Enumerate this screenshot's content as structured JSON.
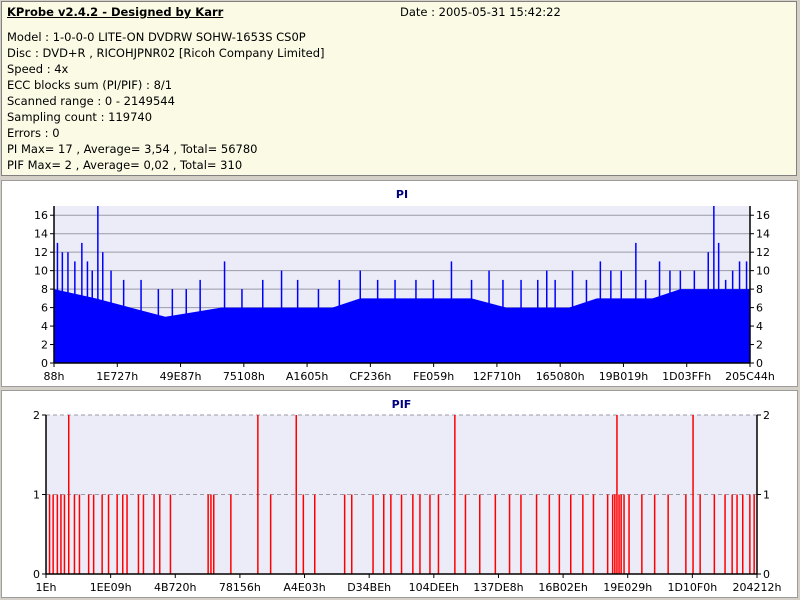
{
  "header": {
    "title": "KProbe v2.4.2 - Designed by Karr",
    "date": "Date : 2005-05-31 15:42:22",
    "lines": [
      "Model : 1-0-0-0 LITE-ON DVDRW SOHW-1653S CS0P",
      "Disc : DVD+R , RICOHJPNR02 [Ricoh Company Limited]",
      "Speed : 4x",
      "ECC blocks sum (PI/PIF) : 8/1",
      "Scanned range : 0 - 2149544",
      "Sampling count : 119740",
      "Errors : 0",
      "PI Max= 17 , Average= 3,54 , Total= 56780",
      "PIF Max= 2 , Average= 0,02 , Total= 310"
    ]
  },
  "colors": {
    "pi": "#0000ff",
    "pif": "#ff0000",
    "plot_bg": "#ececf8"
  },
  "chart_data": [
    {
      "type": "bar",
      "title": "PI",
      "ylim": [
        0,
        17
      ],
      "yticks": [
        "0",
        "2",
        "4",
        "6",
        "8",
        "10",
        "12",
        "14",
        "16"
      ],
      "xticks": [
        "88h",
        "1E727h",
        "49E87h",
        "75108h",
        "A1605h",
        "CF236h",
        "FE059h",
        "12F710h",
        "165080h",
        "19B019h",
        "1D03FFh",
        "205C44h"
      ],
      "baseline_profile": [
        {
          "x": 0.0,
          "y": 8
        },
        {
          "x": 0.06,
          "y": 7
        },
        {
          "x": 0.11,
          "y": 6
        },
        {
          "x": 0.16,
          "y": 5
        },
        {
          "x": 0.2,
          "y": 5.5
        },
        {
          "x": 0.24,
          "y": 6
        },
        {
          "x": 0.4,
          "y": 6
        },
        {
          "x": 0.44,
          "y": 7
        },
        {
          "x": 0.6,
          "y": 7
        },
        {
          "x": 0.65,
          "y": 6
        },
        {
          "x": 0.74,
          "y": 6
        },
        {
          "x": 0.78,
          "y": 7
        },
        {
          "x": 0.86,
          "y": 7
        },
        {
          "x": 0.9,
          "y": 8
        },
        {
          "x": 1.0,
          "y": 8
        }
      ],
      "spikes": [
        {
          "x": 0.005,
          "y": 13
        },
        {
          "x": 0.012,
          "y": 12
        },
        {
          "x": 0.02,
          "y": 12
        },
        {
          "x": 0.03,
          "y": 11
        },
        {
          "x": 0.04,
          "y": 13
        },
        {
          "x": 0.048,
          "y": 11
        },
        {
          "x": 0.055,
          "y": 10
        },
        {
          "x": 0.063,
          "y": 17
        },
        {
          "x": 0.07,
          "y": 12
        },
        {
          "x": 0.082,
          "y": 10
        },
        {
          "x": 0.1,
          "y": 9
        },
        {
          "x": 0.125,
          "y": 9
        },
        {
          "x": 0.15,
          "y": 8
        },
        {
          "x": 0.17,
          "y": 8
        },
        {
          "x": 0.19,
          "y": 8
        },
        {
          "x": 0.21,
          "y": 9
        },
        {
          "x": 0.245,
          "y": 11
        },
        {
          "x": 0.27,
          "y": 8
        },
        {
          "x": 0.3,
          "y": 9
        },
        {
          "x": 0.327,
          "y": 10
        },
        {
          "x": 0.35,
          "y": 9
        },
        {
          "x": 0.38,
          "y": 8
        },
        {
          "x": 0.41,
          "y": 9
        },
        {
          "x": 0.44,
          "y": 10
        },
        {
          "x": 0.465,
          "y": 9
        },
        {
          "x": 0.49,
          "y": 9
        },
        {
          "x": 0.52,
          "y": 9
        },
        {
          "x": 0.545,
          "y": 9
        },
        {
          "x": 0.571,
          "y": 11
        },
        {
          "x": 0.6,
          "y": 9
        },
        {
          "x": 0.625,
          "y": 10
        },
        {
          "x": 0.645,
          "y": 9
        },
        {
          "x": 0.671,
          "y": 9
        },
        {
          "x": 0.695,
          "y": 9
        },
        {
          "x": 0.708,
          "y": 10
        },
        {
          "x": 0.72,
          "y": 9
        },
        {
          "x": 0.745,
          "y": 10
        },
        {
          "x": 0.765,
          "y": 9
        },
        {
          "x": 0.785,
          "y": 11
        },
        {
          "x": 0.8,
          "y": 10
        },
        {
          "x": 0.815,
          "y": 10
        },
        {
          "x": 0.836,
          "y": 13
        },
        {
          "x": 0.85,
          "y": 9
        },
        {
          "x": 0.87,
          "y": 11
        },
        {
          "x": 0.885,
          "y": 10
        },
        {
          "x": 0.9,
          "y": 10
        },
        {
          "x": 0.92,
          "y": 10
        },
        {
          "x": 0.94,
          "y": 12
        },
        {
          "x": 0.948,
          "y": 17
        },
        {
          "x": 0.955,
          "y": 13
        },
        {
          "x": 0.965,
          "y": 9
        },
        {
          "x": 0.975,
          "y": 10
        },
        {
          "x": 0.985,
          "y": 11
        },
        {
          "x": 0.995,
          "y": 11
        }
      ]
    },
    {
      "type": "bar",
      "title": "PIF",
      "ylim": [
        0,
        2
      ],
      "yticks": [
        "0",
        "1",
        "2"
      ],
      "xticks": [
        "1Eh",
        "1EE09h",
        "4B720h",
        "78156h",
        "A4E03h",
        "D34BEh",
        "104DEEh",
        "137DE8h",
        "16B02Eh",
        "19E029h",
        "1D10F0h",
        "204212h"
      ],
      "bars": [
        {
          "x": 0.005,
          "y": 1
        },
        {
          "x": 0.01,
          "y": 1
        },
        {
          "x": 0.016,
          "y": 1
        },
        {
          "x": 0.021,
          "y": 1
        },
        {
          "x": 0.026,
          "y": 1
        },
        {
          "x": 0.032,
          "y": 2
        },
        {
          "x": 0.04,
          "y": 1
        },
        {
          "x": 0.047,
          "y": 1
        },
        {
          "x": 0.06,
          "y": 1
        },
        {
          "x": 0.067,
          "y": 1
        },
        {
          "x": 0.079,
          "y": 1
        },
        {
          "x": 0.088,
          "y": 1
        },
        {
          "x": 0.1,
          "y": 1
        },
        {
          "x": 0.108,
          "y": 1
        },
        {
          "x": 0.114,
          "y": 1
        },
        {
          "x": 0.13,
          "y": 1
        },
        {
          "x": 0.137,
          "y": 1
        },
        {
          "x": 0.152,
          "y": 1
        },
        {
          "x": 0.16,
          "y": 1
        },
        {
          "x": 0.175,
          "y": 1
        },
        {
          "x": 0.228,
          "y": 1
        },
        {
          "x": 0.232,
          "y": 1
        },
        {
          "x": 0.236,
          "y": 1
        },
        {
          "x": 0.26,
          "y": 1
        },
        {
          "x": 0.298,
          "y": 2
        },
        {
          "x": 0.316,
          "y": 1
        },
        {
          "x": 0.352,
          "y": 2
        },
        {
          "x": 0.362,
          "y": 1
        },
        {
          "x": 0.378,
          "y": 1
        },
        {
          "x": 0.42,
          "y": 1
        },
        {
          "x": 0.43,
          "y": 1
        },
        {
          "x": 0.46,
          "y": 1
        },
        {
          "x": 0.475,
          "y": 1
        },
        {
          "x": 0.485,
          "y": 1
        },
        {
          "x": 0.5,
          "y": 1
        },
        {
          "x": 0.516,
          "y": 1
        },
        {
          "x": 0.526,
          "y": 1
        },
        {
          "x": 0.54,
          "y": 1
        },
        {
          "x": 0.552,
          "y": 1
        },
        {
          "x": 0.575,
          "y": 2
        },
        {
          "x": 0.59,
          "y": 1
        },
        {
          "x": 0.61,
          "y": 1
        },
        {
          "x": 0.632,
          "y": 1
        },
        {
          "x": 0.652,
          "y": 1
        },
        {
          "x": 0.668,
          "y": 1
        },
        {
          "x": 0.69,
          "y": 1
        },
        {
          "x": 0.708,
          "y": 1
        },
        {
          "x": 0.722,
          "y": 1
        },
        {
          "x": 0.738,
          "y": 1
        },
        {
          "x": 0.755,
          "y": 1
        },
        {
          "x": 0.77,
          "y": 1
        },
        {
          "x": 0.79,
          "y": 1
        },
        {
          "x": 0.797,
          "y": 1
        },
        {
          "x": 0.8,
          "y": 1
        },
        {
          "x": 0.803,
          "y": 2
        },
        {
          "x": 0.806,
          "y": 1
        },
        {
          "x": 0.809,
          "y": 1
        },
        {
          "x": 0.813,
          "y": 1
        },
        {
          "x": 0.82,
          "y": 1
        },
        {
          "x": 0.838,
          "y": 1
        },
        {
          "x": 0.856,
          "y": 1
        },
        {
          "x": 0.875,
          "y": 1
        },
        {
          "x": 0.9,
          "y": 1
        },
        {
          "x": 0.91,
          "y": 2
        },
        {
          "x": 0.92,
          "y": 1
        },
        {
          "x": 0.94,
          "y": 1
        },
        {
          "x": 0.955,
          "y": 1
        },
        {
          "x": 0.965,
          "y": 1
        },
        {
          "x": 0.972,
          "y": 1
        },
        {
          "x": 0.98,
          "y": 1
        },
        {
          "x": 0.99,
          "y": 1
        },
        {
          "x": 0.996,
          "y": 1
        }
      ]
    }
  ]
}
